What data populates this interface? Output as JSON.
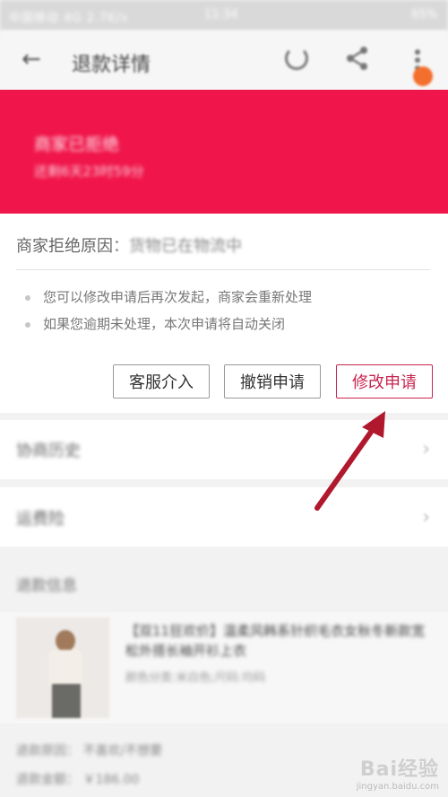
{
  "status_bar": {
    "left": "中国移动 4G 2.7K/s",
    "time": "11:34",
    "right": "65%"
  },
  "nav": {
    "title": "退款详情",
    "back_icon": "back-arrow-icon",
    "refresh_icon": "refresh-icon",
    "share_icon": "share-icon",
    "more_icon": "more-vertical-icon"
  },
  "banner": {
    "title": "商家已拒绝",
    "subtitle": "还剩6天23时59分"
  },
  "refusal": {
    "label": "商家拒绝原因",
    "separator": "：",
    "value": "货物已在物流中"
  },
  "tips": [
    "您可以修改申请后再次发起，商家会重新处理",
    "如果您逾期未处理，本次申请将自动关闭"
  ],
  "buttons": {
    "service": "客服介入",
    "cancel": "撤销申请",
    "modify": "修改申请"
  },
  "rows": [
    {
      "label": "协商历史",
      "chevron": "›"
    },
    {
      "label": "运费险",
      "chevron": "›"
    }
  ],
  "refund_section_title": "退款信息",
  "product": {
    "title": "【双11狂欢价】温柔风韩系针织毛衣女秋冬新款宽松外搭长袖开衫上衣",
    "spec": "颜色分类:米白色;尺码:均码"
  },
  "refund_info": {
    "reason_row": "退款原因：   不喜欢/不想要",
    "amount_row": "退款金额：   ￥186.00"
  },
  "watermark": {
    "logo": "Bai经验",
    "url": "jingyan.baidu.com"
  },
  "colors": {
    "banner": "#f0154a",
    "accent": "#c8254f",
    "arrow": "#b0182e"
  }
}
